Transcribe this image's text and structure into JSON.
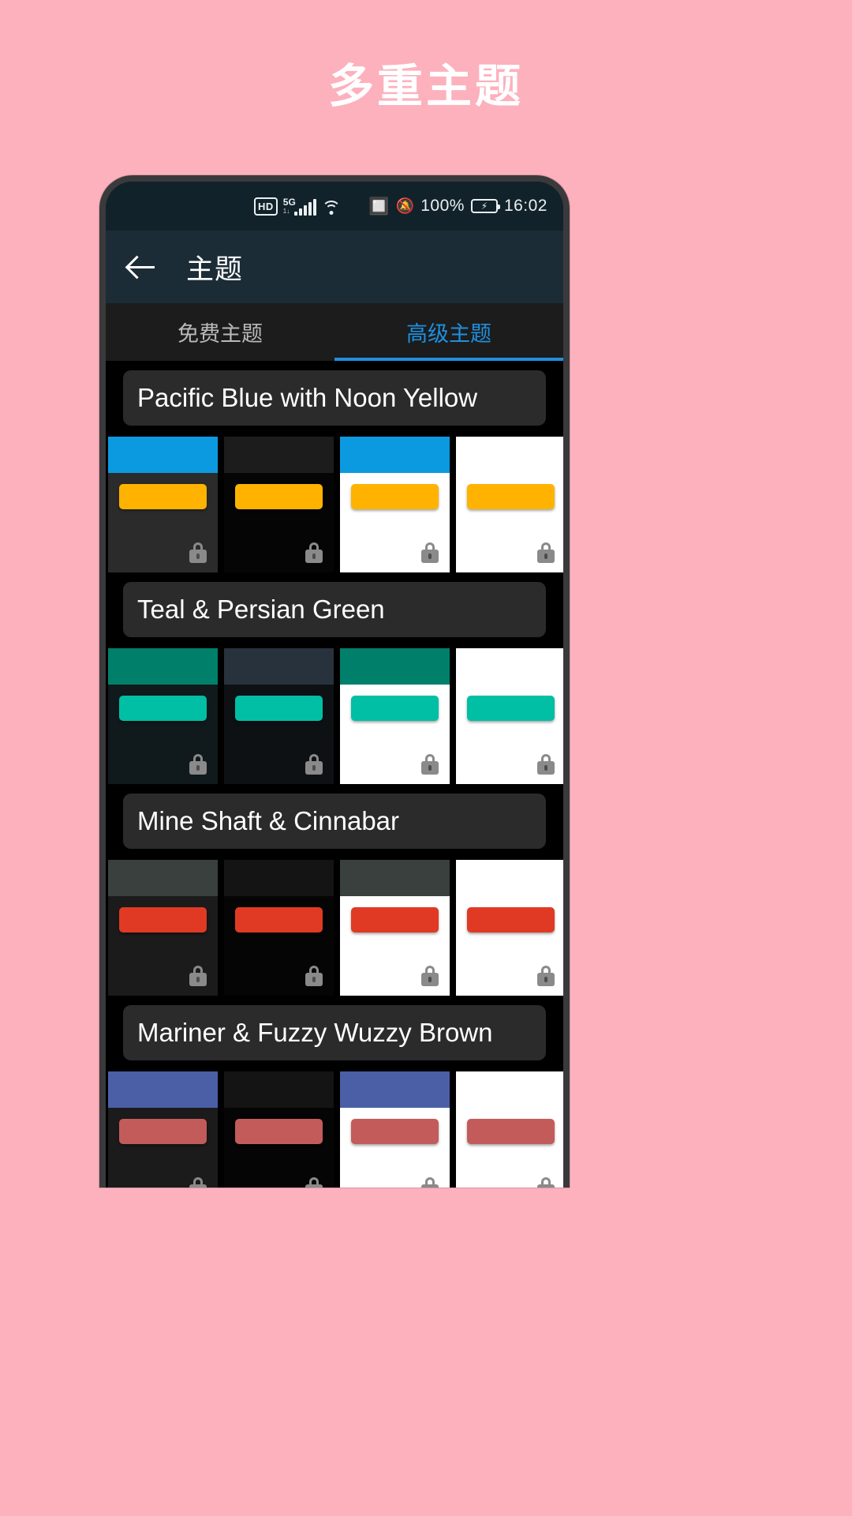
{
  "promo": {
    "title": "多重主题",
    "background_color": "#fcb1bd",
    "title_color": "#ffffff"
  },
  "statusbar": {
    "hd_label": "HD",
    "network_label": "5G",
    "network_sub": "1↓",
    "wifi_icon": "wifi-icon",
    "bluetooth_icon": "bluetooth-icon",
    "silent_icon": "bell-muted-icon",
    "battery_text": "100%",
    "battery_icon": "battery-charging-icon",
    "time": "16:02"
  },
  "appbar": {
    "back_icon": "arrow-left-icon",
    "title": "主题"
  },
  "tabs": [
    {
      "label": "免费主题",
      "active": false
    },
    {
      "label": "高级主题",
      "active": true
    }
  ],
  "accent_color": "#1e90e0",
  "themes": [
    {
      "name": "Pacific Blue with Noon Yellow",
      "locked": true,
      "variants": [
        {
          "header": "#0b9ae0",
          "body": "#2b2b2b",
          "button": "#ffb300",
          "lock": "#8a8a8a"
        },
        {
          "header": "#1c1c1c",
          "body": "#050505",
          "button": "#ffb300",
          "lock": "#8a8a8a"
        },
        {
          "header": "#0b9ae0",
          "body": "#ffffff",
          "button": "#ffb300",
          "lock": "#8a8a8a"
        },
        {
          "header": "#ffffff",
          "body": "#ffffff",
          "button": "#ffb300",
          "lock": "#8a8a8a"
        }
      ]
    },
    {
      "name": "Teal & Persian Green",
      "locked": true,
      "variants": [
        {
          "header": "#00806b",
          "body": "#10191c",
          "button": "#00bfa5",
          "lock": "#8a8a8a"
        },
        {
          "header": "#28323d",
          "body": "#0d1114",
          "button": "#00bfa5",
          "lock": "#8a8a8a"
        },
        {
          "header": "#00806b",
          "body": "#ffffff",
          "button": "#00bfa5",
          "lock": "#8a8a8a"
        },
        {
          "header": "#ffffff",
          "body": "#ffffff",
          "button": "#00bfa5",
          "lock": "#8a8a8a"
        }
      ]
    },
    {
      "name": "Mine Shaft & Cinnabar",
      "locked": true,
      "variants": [
        {
          "header": "#39403e",
          "body": "#1b1b1b",
          "button": "#e03a24",
          "lock": "#8a8a8a"
        },
        {
          "header": "#141414",
          "body": "#050505",
          "button": "#e03a24",
          "lock": "#8a8a8a"
        },
        {
          "header": "#39403e",
          "body": "#ffffff",
          "button": "#e03a24",
          "lock": "#8a8a8a"
        },
        {
          "header": "#ffffff",
          "body": "#ffffff",
          "button": "#e03a24",
          "lock": "#8a8a8a"
        }
      ]
    },
    {
      "name": "Mariner & Fuzzy Wuzzy Brown",
      "locked": true,
      "variants": [
        {
          "header": "#4a5fa5",
          "body": "#1b1b1b",
          "button": "#c35b5b",
          "lock": "#8a8a8a"
        },
        {
          "header": "#141414",
          "body": "#050505",
          "button": "#c35b5b",
          "lock": "#8a8a8a"
        },
        {
          "header": "#4a5fa5",
          "body": "#ffffff",
          "button": "#c35b5b",
          "lock": "#8a8a8a"
        },
        {
          "header": "#ffffff",
          "body": "#ffffff",
          "button": "#c35b5b",
          "lock": "#8a8a8a"
        }
      ]
    }
  ]
}
